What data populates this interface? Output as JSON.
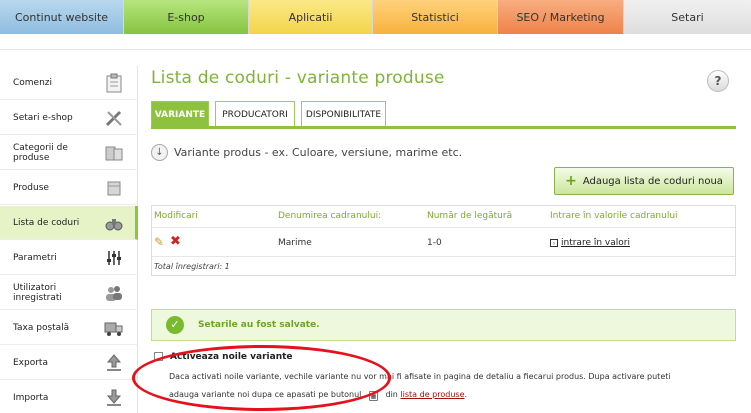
{
  "topnav": [
    {
      "label": "Continut website"
    },
    {
      "label": "E-shop"
    },
    {
      "label": "Aplicatii"
    },
    {
      "label": "Statistici"
    },
    {
      "label": "SEO / Marketing"
    },
    {
      "label": "Setari"
    }
  ],
  "sidebar": {
    "items": [
      {
        "label": "Comenzi",
        "icon": "clipboard-icon"
      },
      {
        "label": "Setari e-shop",
        "icon": "tools-icon"
      },
      {
        "label": "Categorii de produse",
        "icon": "boxes-icon"
      },
      {
        "label": "Produse",
        "icon": "box-icon"
      },
      {
        "label": "Lista de coduri",
        "icon": "binoculars-icon"
      },
      {
        "label": "Parametri",
        "icon": "sliders-icon"
      },
      {
        "label": "Utilizatori inregistrati",
        "icon": "users-icon"
      },
      {
        "label": "Taxa poștală",
        "icon": "truck-icon"
      },
      {
        "label": "Exporta",
        "icon": "upload-icon"
      },
      {
        "label": "Importa",
        "icon": "download-icon"
      }
    ]
  },
  "page": {
    "title": "Lista de coduri - variante produse",
    "help": "?"
  },
  "tabs": [
    {
      "label": "VARIANTE"
    },
    {
      "label": "PRODUCATORI"
    },
    {
      "label": "DISPONIBILITATE"
    }
  ],
  "subheading": "Variante produs - ex. Culoare, versiune, marime etc.",
  "add_button": "Adauga lista de coduri noua",
  "table": {
    "headers": [
      "Modificari",
      "Denumirea cadranului:",
      "Număr de legătură",
      "Intrare în valorile cadranului"
    ],
    "rows": [
      {
        "name": "Marime",
        "number": "1-0",
        "link": "intrare în valori"
      }
    ],
    "total": "Total înregistrari: 1"
  },
  "success_message": "Setarile au fost salvate.",
  "option": {
    "label": "Activeaza noile variante",
    "checked": false,
    "desc_line1": "Daca activati noile variante, vechile variante nu vor mai fi afisate in pagina de detaliu a fiecarui produs. Dupa activare puteti",
    "desc_line2_prefix": "adauga variante noi dupa ce apasati pe butonul",
    "desc_line2_mid": "din",
    "desc_link": "lista de produse",
    "desc_line2_suffix": "."
  }
}
